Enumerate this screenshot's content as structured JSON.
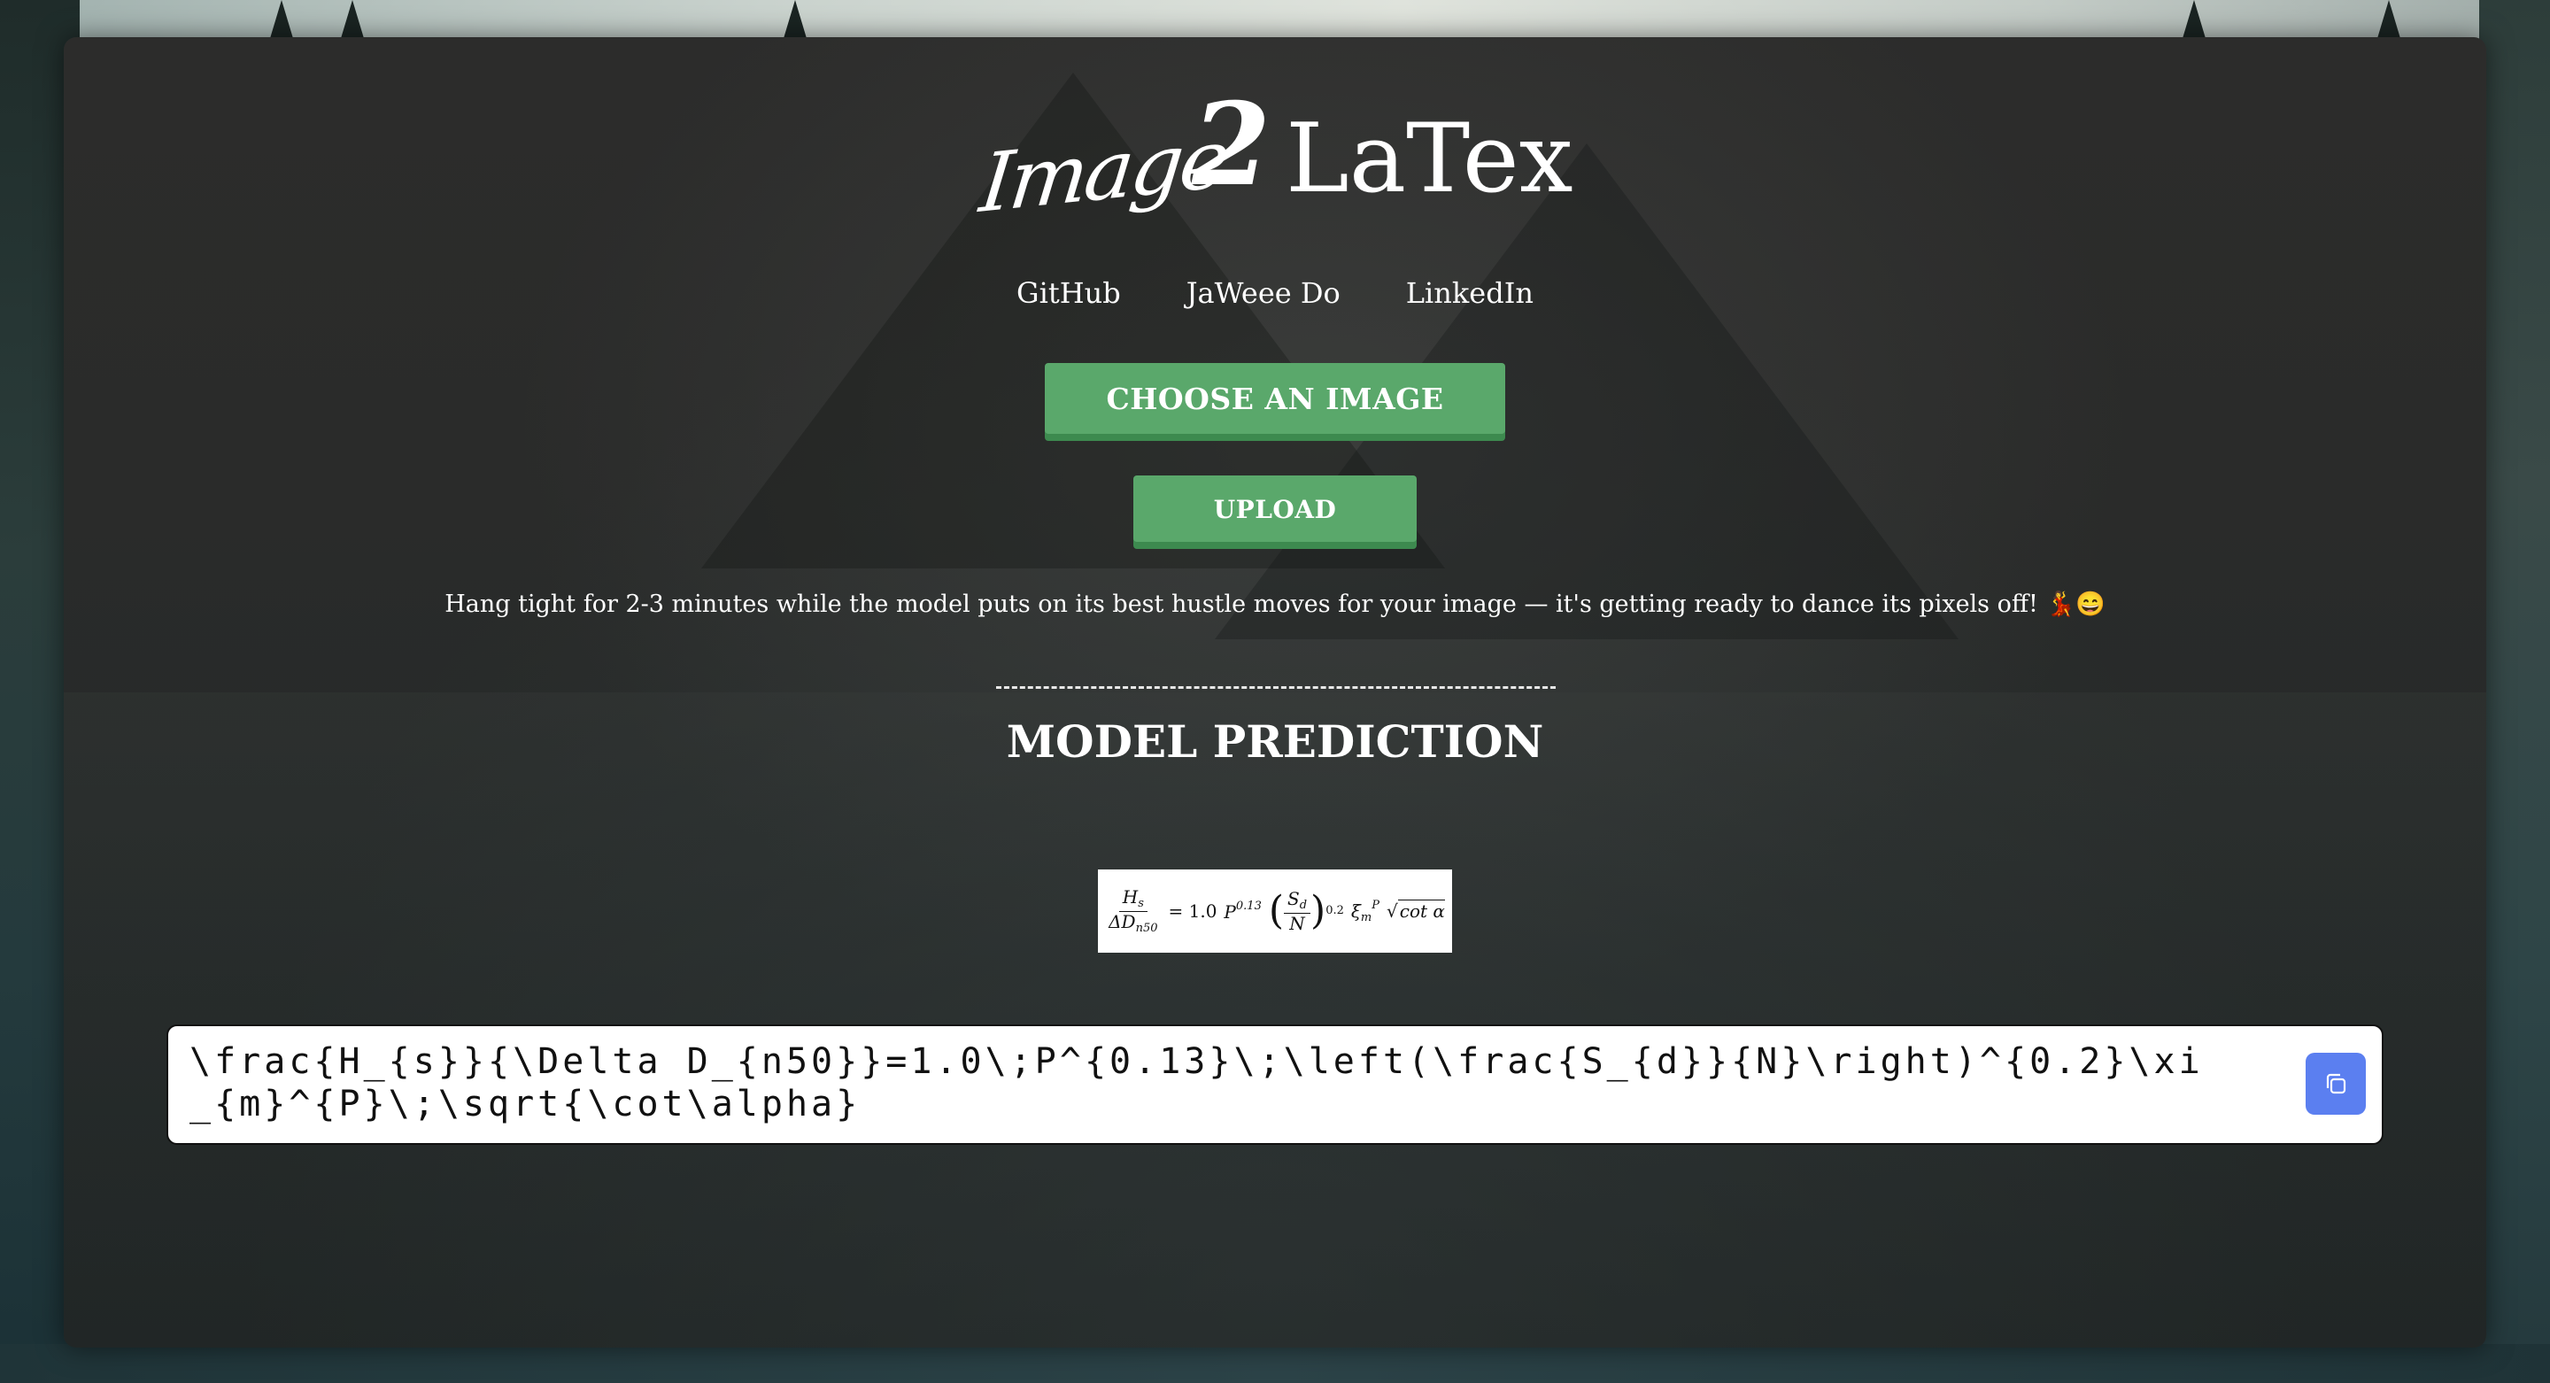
{
  "logo": {
    "part1": "Image",
    "part2": "2",
    "part3": "LaTex"
  },
  "nav": {
    "items": [
      {
        "label": "GitHub"
      },
      {
        "label": "JaWeee Do"
      },
      {
        "label": "LinkedIn"
      }
    ]
  },
  "buttons": {
    "choose_label": "CHOOSE AN IMAGE",
    "upload_label": "UPLOAD"
  },
  "message": {
    "text": "Hang tight for 2-3 minutes while the model puts on its best hustle moves for your image — it's getting ready to dance its pixels off! 💃😄"
  },
  "prediction": {
    "title": "MODEL PREDICTION",
    "formula": {
      "lhs_num": "H",
      "lhs_num_sub": "s",
      "lhs_den": "ΔD",
      "lhs_den_sub": "n50",
      "equals": "= 1.0",
      "p": "P",
      "p_sup": "0.13",
      "ratio_num": "S",
      "ratio_num_sub": "d",
      "ratio_den": "N",
      "ratio_sup": "0.2",
      "xi": "ξ",
      "xi_sub": "m",
      "xi_sup": "P",
      "sqrt_sign": "√",
      "sqrt_body": "cot α"
    },
    "latex": "\\frac{H_{s}}{\\Delta D_{n50}}=1.0\\;P^{0.13}\\;\\left(\\frac{S_{d}}{N}\\right)^{0.2}\\xi_{m}^{P}\\;\\sqrt{\\cot\\alpha}"
  },
  "colors": {
    "button_green": "#5aa86b",
    "copy_blue": "#5b7ff0"
  },
  "icons": {
    "copy": "copy-icon"
  }
}
